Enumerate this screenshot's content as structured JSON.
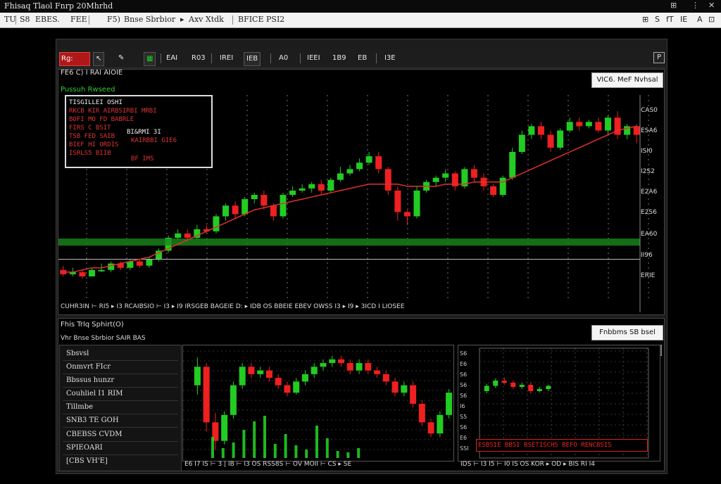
{
  "window": {
    "title": "Fhisaq   Tlaol Fnrp  20Mhrhd",
    "controls": [
      "⊞",
      "⋮",
      "✕"
    ]
  },
  "menubar": {
    "items": [
      "TU",
      "S8",
      "EBES.",
      "FEE",
      "F5)",
      "Bnse Sbrbior",
      "▸",
      "Axv Xtdk",
      "BFICE PSI2"
    ],
    "right_items": [
      "⊞",
      "S",
      "fT",
      "IE",
      "A",
      "⊡"
    ]
  },
  "toolbar": {
    "items": [
      "Rg:",
      "EAI",
      "R03",
      "IREI",
      "IEB",
      "A0",
      "IEEI",
      "1B9",
      "EB",
      "I3E"
    ],
    "window_icon": "P"
  },
  "main_panel": {
    "title": "FE6 C) I RAI AIOIE",
    "subtitle": "Pussuh Rwseed",
    "button": "VIC6. MeF Nvhsal",
    "info_box": {
      "lines": [
        "TISGILLEI OSHI",
        "RKCB KIR AIRBSIRBI MRBI",
        "BOFI MO FD BABRLE",
        "FIRS C BSIT",
        "TSB FED SAIB",
        "BIEF HI ORDIS",
        "ISRLS5 BIIB"
      ],
      "right_lines": [
        "BI&RMI 3I",
        "KAIRBBI GIE6",
        "BF IMS"
      ]
    },
    "y_axis": [
      "CAS0",
      "ESA6",
      "ISI0",
      "I2S2",
      "E2A6",
      "E2S6",
      "EA60",
      "II96",
      "ERIE"
    ],
    "x_axis": "CUHR3IN  ⊢ RI5 ▸ I3 RCAIBSIO  ⊢  I3  ▸ I9  IRSGEB  BAGEIE  D:  ▸ IDB  OS BBEIE  EBEV  OWSS  I3  ▸ I9  ▸ 3ICD  I LIOSEE",
    "colors": {
      "up": "#22cc22",
      "down": "#ee2020",
      "ma_line": "#e03030",
      "support_line": "#1a8a1a"
    }
  },
  "lower_panel": {
    "title": "Fhis Trlq Sphirt(O)",
    "subtitle": "Vhr  Bnse Sbrbior SAIR BAS",
    "button": "Fnbbms SB bsel",
    "sidebar": [
      "Sbsvsl",
      "Onmvrt FIcr",
      "Bbssus hunzr",
      "Couhliel I1 RIM",
      "Tillmbe",
      "SNB3 TE GOH",
      "CBEBSS CVDM",
      "SPIEOARI",
      "[CBS VH'E]"
    ],
    "mid_x_axis": "E6 I7 IS  ⊢ 3  |  IB  ⊢  I3  OS RSS8S  ⊢ OV MOII  ⊢ CS  ▸ SE",
    "right_x_axis": "IDS  ⊢ I3  I5  ⊢ I0  IS  OS  KOR  ▸  OD  ▸  BIS  RI  I4",
    "right_y_axis": [
      "S6",
      "E6",
      "S6",
      "S6",
      "S6",
      "I6",
      "S5",
      "S6",
      "E6",
      "SSI"
    ],
    "red_banner": "ESBSIE BBSI BSETISCHS BEFO RENCBSIS"
  },
  "chart_data": [
    {
      "type": "candlestick",
      "title": "FE6 C) I RAI AIOIE",
      "series": [
        {
          "values": [
            [
              5,
              3,
              7,
              2
            ],
            [
              3,
              4,
              6,
              2
            ],
            [
              4,
              2,
              5,
              1
            ],
            [
              2,
              5,
              6,
              2
            ],
            [
              5,
              5,
              8,
              4
            ],
            [
              5,
              8,
              9,
              4
            ],
            [
              8,
              6,
              9,
              5
            ],
            [
              6,
              9,
              10,
              5
            ],
            [
              9,
              7,
              10,
              6
            ],
            [
              7,
              10,
              11,
              6
            ],
            [
              10,
              14,
              15,
              9
            ],
            [
              14,
              20,
              21,
              13
            ],
            [
              20,
              22,
              24,
              19
            ],
            [
              22,
              20,
              24,
              18
            ],
            [
              20,
              24,
              26,
              19
            ],
            [
              24,
              23,
              26,
              22
            ],
            [
              23,
              30,
              31,
              22
            ],
            [
              30,
              35,
              36,
              28
            ],
            [
              35,
              31,
              37,
              29
            ],
            [
              31,
              38,
              39,
              30
            ],
            [
              38,
              40,
              41,
              36
            ],
            [
              40,
              35,
              42,
              33
            ],
            [
              35,
              30,
              36,
              28
            ],
            [
              30,
              40,
              41,
              29
            ],
            [
              40,
              42,
              44,
              39
            ],
            [
              42,
              43,
              45,
              41
            ],
            [
              43,
              45,
              46,
              41
            ],
            [
              45,
              42,
              47,
              40
            ],
            [
              42,
              47,
              48,
              41
            ],
            [
              47,
              50,
              53,
              46
            ],
            [
              50,
              52,
              54,
              49
            ],
            [
              52,
              55,
              57,
              51
            ],
            [
              55,
              58,
              60,
              54
            ],
            [
              58,
              52,
              60,
              50
            ],
            [
              52,
              42,
              53,
              40
            ],
            [
              42,
              32,
              44,
              28
            ],
            [
              32,
              30,
              33,
              26
            ],
            [
              30,
              42,
              44,
              29
            ],
            [
              42,
              46,
              47,
              41
            ],
            [
              46,
              48,
              49,
              44
            ],
            [
              48,
              50,
              52,
              46
            ],
            [
              50,
              44,
              51,
              42
            ],
            [
              44,
              52,
              53,
              43
            ],
            [
              52,
              48,
              54,
              46
            ],
            [
              48,
              44,
              50,
              42
            ],
            [
              44,
              40,
              45,
              39
            ],
            [
              40,
              48,
              49,
              39
            ],
            [
              48,
              60,
              62,
              47
            ],
            [
              60,
              68,
              70,
              59
            ],
            [
              68,
              72,
              73,
              66
            ],
            [
              72,
              68,
              74,
              66
            ],
            [
              68,
              62,
              70,
              60
            ],
            [
              62,
              70,
              71,
              61
            ],
            [
              70,
              74,
              76,
              69
            ],
            [
              74,
              72,
              76,
              70
            ],
            [
              72,
              74,
              75,
              71
            ],
            [
              74,
              70,
              76,
              69
            ],
            [
              70,
              76,
              77,
              68
            ],
            [
              76,
              68,
              79,
              66
            ],
            [
              68,
              72,
              73,
              66
            ],
            [
              72,
              68,
              73,
              64
            ]
          ]
        }
      ],
      "ma": [
        4,
        4,
        5,
        6,
        6,
        7,
        8,
        9,
        10,
        11,
        13,
        15,
        17,
        19,
        21,
        23,
        25,
        27,
        29,
        31,
        33,
        34,
        35,
        36,
        37,
        38,
        39,
        40,
        41,
        42,
        43,
        44,
        45,
        45,
        45,
        45,
        44,
        44,
        44,
        44,
        45,
        45,
        45,
        46,
        46,
        46,
        46,
        48,
        50,
        52,
        54,
        56,
        58,
        60,
        62,
        64,
        66,
        68,
        70,
        71,
        72
      ],
      "support_levels": [
        18,
        10
      ]
    },
    {
      "type": "candlestick",
      "title": "Fhis Trlq Sphirt(O)",
      "series": [
        {
          "values": [
            [
              60,
              70,
              75,
              55
            ],
            [
              70,
              40,
              72,
              35
            ],
            [
              40,
              30,
              45,
              25
            ],
            [
              30,
              44,
              46,
              28
            ],
            [
              44,
              60,
              62,
              42
            ],
            [
              60,
              70,
              72,
              58
            ],
            [
              70,
              66,
              72,
              64
            ],
            [
              66,
              68,
              70,
              64
            ],
            [
              68,
              64,
              70,
              62
            ],
            [
              64,
              60,
              66,
              58
            ],
            [
              60,
              56,
              62,
              54
            ],
            [
              56,
              62,
              64,
              55
            ],
            [
              62,
              66,
              68,
              60
            ],
            [
              66,
              70,
              72,
              64
            ],
            [
              70,
              72,
              74,
              68
            ],
            [
              72,
              74,
              76,
              70
            ],
            [
              74,
              72,
              76,
              70
            ],
            [
              72,
              68,
              74,
              66
            ],
            [
              68,
              72,
              74,
              66
            ],
            [
              72,
              68,
              74,
              66
            ],
            [
              68,
              66,
              70,
              64
            ],
            [
              66,
              62,
              68,
              60
            ],
            [
              62,
              56,
              64,
              54
            ],
            [
              56,
              60,
              62,
              54
            ],
            [
              60,
              50,
              62,
              48
            ],
            [
              50,
              40,
              52,
              38
            ],
            [
              40,
              34,
              42,
              32
            ],
            [
              34,
              44,
              46,
              32
            ],
            [
              44,
              56,
              58,
              42
            ]
          ]
        }
      ],
      "volume": [
        30,
        14,
        22,
        40,
        52,
        60,
        20,
        34,
        18,
        12,
        46,
        28,
        10,
        8,
        14
      ]
    },
    {
      "type": "candlestick",
      "series": [
        {
          "values": [
            [
              50,
              55,
              57,
              48
            ],
            [
              55,
              60,
              62,
              53
            ],
            [
              60,
              58,
              63,
              56
            ],
            [
              58,
              54,
              60,
              52
            ],
            [
              54,
              56,
              58,
              52
            ],
            [
              56,
              50,
              58,
              48
            ],
            [
              50,
              52,
              54,
              49
            ],
            [
              52,
              55,
              56,
              50
            ]
          ]
        }
      ]
    }
  ]
}
